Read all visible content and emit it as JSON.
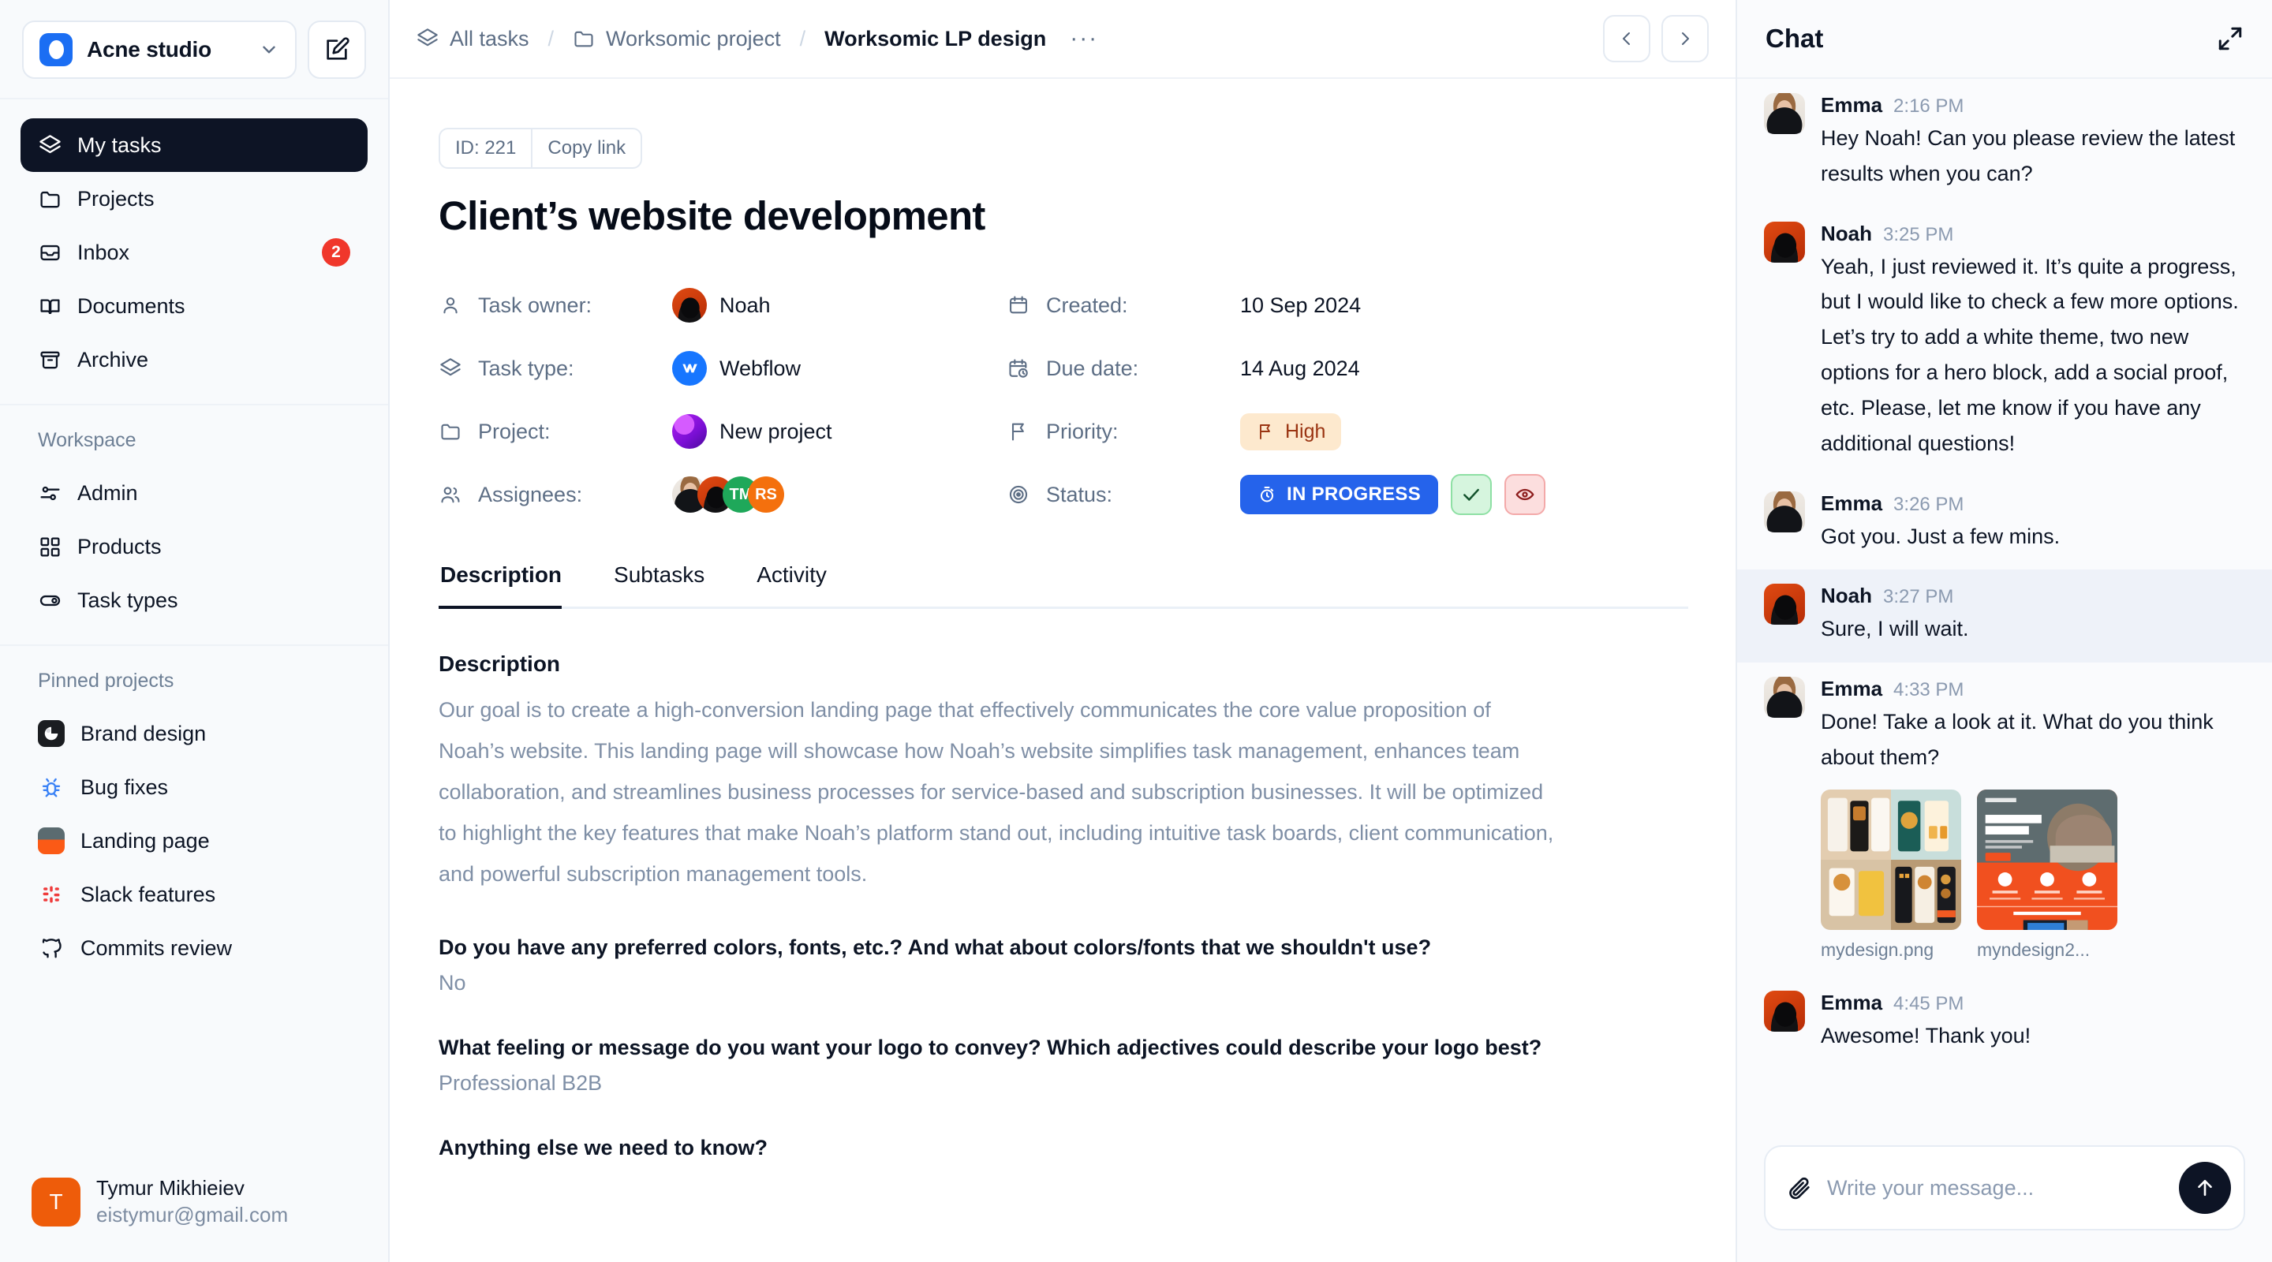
{
  "sidebar": {
    "workspace_name": "Acne studio",
    "edit_icon": "edit-square-icon",
    "nav": [
      {
        "label": "My tasks",
        "icon": "layers-icon",
        "active": true
      },
      {
        "label": "Projects",
        "icon": "folder-icon",
        "active": false
      },
      {
        "label": "Inbox",
        "icon": "inbox-icon",
        "active": false,
        "badge": "2"
      },
      {
        "label": "Documents",
        "icon": "book-icon",
        "active": false
      },
      {
        "label": "Archive",
        "icon": "archive-icon",
        "active": false
      }
    ],
    "workspace_section": {
      "title": "Workspace",
      "items": [
        {
          "label": "Admin",
          "icon": "sliders-icon"
        },
        {
          "label": "Products",
          "icon": "grid-icon"
        },
        {
          "label": "Task types",
          "icon": "toggle-icon"
        }
      ]
    },
    "pinned_section": {
      "title": "Pinned projects",
      "items": [
        {
          "label": "Brand design",
          "icon": "brand-logo-icon"
        },
        {
          "label": "Bug fixes",
          "icon": "bug-icon"
        },
        {
          "label": "Landing page",
          "icon": "landing-thumb-icon"
        },
        {
          "label": "Slack features",
          "icon": "slack-icon"
        },
        {
          "label": "Commits review",
          "icon": "github-icon"
        }
      ]
    },
    "user": {
      "initial": "T",
      "name": "Tymur Mikhieiev",
      "email": "eistymur@gmail.com"
    }
  },
  "topbar": {
    "breadcrumb": [
      {
        "label": "All tasks",
        "icon": "layers-icon"
      },
      {
        "label": "Worksomic project",
        "icon": "folder-icon"
      },
      {
        "label": "Worksomic LP design",
        "icon": ""
      }
    ],
    "more_label": "···",
    "prev_icon": "chevron-left-icon",
    "next_icon": "chevron-right-icon"
  },
  "task": {
    "id_label": "ID: 221",
    "copy_link_label": "Copy link",
    "title": "Client’s website development",
    "fields_left": [
      {
        "label": "Task owner:",
        "icon": "user-icon",
        "value": "Noah",
        "avatar": "photo-noah"
      },
      {
        "label": "Task type:",
        "icon": "layers-icon",
        "value": "Webflow",
        "avatar": "webflow-logo"
      },
      {
        "label": "Project:",
        "icon": "folder-icon",
        "value": "New project",
        "avatar": "photo-project"
      },
      {
        "label": "Assignees:",
        "icon": "users-icon",
        "value": "",
        "avatar": "avatar-group"
      }
    ],
    "assignees": [
      {
        "type": "photo",
        "key": "emma"
      },
      {
        "type": "photo",
        "key": "noah"
      },
      {
        "type": "initials",
        "text": "TM",
        "color": "#1fa85a"
      },
      {
        "type": "initials",
        "text": "RS",
        "color": "#f4700d"
      }
    ],
    "fields_right": [
      {
        "label": "Created:",
        "icon": "calendar-icon",
        "value": "10 Sep 2024"
      },
      {
        "label": "Due date:",
        "icon": "calendar-clock-icon",
        "value": "14 Aug 2024"
      },
      {
        "label": "Priority:",
        "icon": "flag-icon",
        "value": "High"
      },
      {
        "label": "Status:",
        "icon": "target-icon",
        "value": "IN PROGRESS"
      }
    ],
    "priority_badge": {
      "text": "High",
      "icon": "flag-icon",
      "bg": "#fde9ce",
      "fg": "#9a3412"
    },
    "status_badge": {
      "text": "IN PROGRESS",
      "icon": "timer-icon",
      "bg": "#2563eb",
      "fg": "#ffffff"
    },
    "status_actions": [
      {
        "icon": "check-icon",
        "name": "approve-button",
        "bg": "#d6f5de",
        "fg": "#14532d"
      },
      {
        "icon": "eye-icon",
        "name": "watch-button",
        "bg": "#fcdede",
        "fg": "#8d1c1c"
      }
    ],
    "tabs": [
      {
        "label": "Description",
        "active": true
      },
      {
        "label": "Subtasks",
        "active": false
      },
      {
        "label": "Activity",
        "active": false
      }
    ],
    "description_heading": "Description",
    "description_body": "Our goal is to create a high-conversion landing page that effectively communicates the core value proposition of Noah’s website. This landing page will showcase how Noah’s website simplifies task management, enhances team collaboration, and streamlines business processes for service-based and subscription businesses. It will be optimized to highlight the key features that make Noah’s platform stand out, including intuitive task boards, client communication, and powerful subscription management tools.",
    "qa": [
      {
        "question": "Do you have any preferred colors, fonts, etc.? And what about colors/fonts that we shouldn't use?",
        "answer": "No"
      },
      {
        "question": "What feeling or message do you want your logo to convey? Which adjectives could describe your logo best?",
        "answer": "Professional B2B"
      },
      {
        "question": "Anything else we need to know?",
        "answer": ""
      }
    ]
  },
  "chat": {
    "title": "Chat",
    "expand_icon": "expand-icon",
    "messages": [
      {
        "author": "Emma",
        "time": "2:16 PM",
        "avatar": "photo-emma",
        "text": "Hey Noah! Can you please review the latest results when you can?",
        "highlighted": false
      },
      {
        "author": "Noah",
        "time": "3:25 PM",
        "avatar": "photo-noah",
        "text": "Yeah, I just reviewed it. It’s quite a progress, but I would like to check a few more options. Let’s try to add a white theme, two new options for a hero block, add a social proof, etc. Please, let me know if you have any additional questions!",
        "highlighted": false
      },
      {
        "author": "Emma",
        "time": "3:26 PM",
        "avatar": "photo-emma",
        "text": "Got you. Just a few mins.",
        "highlighted": false
      },
      {
        "author": "Noah",
        "time": "3:27 PM",
        "avatar": "photo-noah",
        "text": "Sure, I will wait.",
        "highlighted": true
      },
      {
        "author": "Emma",
        "time": "4:33 PM",
        "avatar": "photo-emma",
        "text": "Done! Take a look at it. What do you think about them?",
        "highlighted": false,
        "attachments": [
          {
            "name": "mydesign.png",
            "thumb": "food-app-screens"
          },
          {
            "name": "myndesign2...",
            "thumb": "make-money-landing"
          }
        ]
      },
      {
        "author": "Emma",
        "time": "4:45 PM",
        "avatar": "photo-noah",
        "text": "Awesome! Thank you!",
        "highlighted": false
      }
    ],
    "composer": {
      "attach_icon": "paperclip-icon",
      "placeholder": "Write your message...",
      "send_icon": "arrow-up-icon"
    }
  },
  "colors": {
    "accent_blue": "#2563eb",
    "brand_blue": "#1b6ef3",
    "danger_red": "#f0372b",
    "dark": "#0d1425",
    "muted": "#7f8fa6",
    "sidebar_bg": "#f8fafc"
  }
}
